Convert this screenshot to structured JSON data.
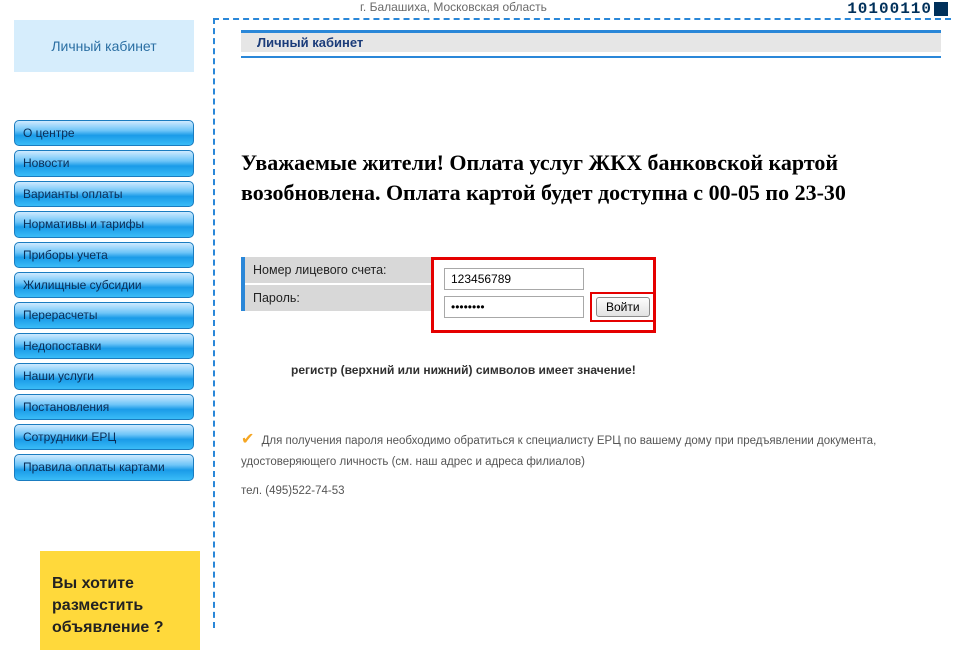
{
  "header": {
    "subtitle": "г. Балашиха, Московская область",
    "logo_digits": "10100110"
  },
  "sidebar": {
    "lk_title": "Личный кабинет",
    "items": [
      "О центре",
      "Новости",
      "Варианты оплаты",
      "Нормативы и тарифы",
      "Приборы учета",
      "Жилищные субсидии",
      "Перерасчеты",
      "Недопоставки",
      "Наши услуги",
      "Постановления",
      "Сотрудники ЕРЦ",
      "Правила оплаты картами"
    ],
    "ad_text": "Вы хотите разместить объявление ?"
  },
  "main": {
    "section_title": "Личный кабинет",
    "announcement": "Уважаемые жители! Оплата услуг ЖКХ банковской картой возобновлена. Оплата картой будет доступна с 00-05 по 23-30",
    "login": {
      "account_label": "Номер лицевого счета:",
      "password_label": "Пароль:",
      "account_value": "123456789",
      "password_value": "••••••••",
      "submit_label": "Войти"
    },
    "case_note": "регистр (верхний или нижний) символов имеет значение!",
    "help_text": "Для получения пароля необходимо обратиться к специалисту ЕРЦ по вашему дому при предъявлении документа, удостоверяющего личность (см. наш адрес и адреса филиалов)",
    "phone": "тел. (495)522-74-53"
  }
}
